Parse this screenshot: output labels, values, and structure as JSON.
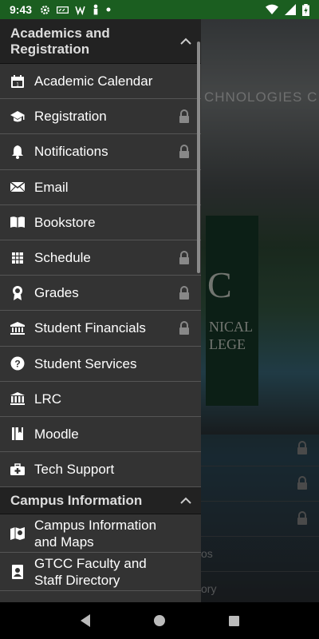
{
  "status_bar": {
    "time": "9:43",
    "left_icons": [
      "settings-icon",
      "quote-icon",
      "w-icon",
      "person-icon",
      "dot-icon"
    ],
    "right_icons": [
      "wifi-icon",
      "signal-icon",
      "battery-icon"
    ]
  },
  "background": {
    "banner_text": "CHNOLOGIES C",
    "sign_text": "C",
    "sign_sub_line1": "NICAL",
    "sign_sub_line2": "LEGE",
    "rows": [
      {
        "label": "",
        "locked": true
      },
      {
        "label": "",
        "locked": true
      },
      {
        "label": "",
        "locked": true
      },
      {
        "label": "os",
        "locked": false
      },
      {
        "label": "ory",
        "locked": false
      }
    ]
  },
  "drawer": {
    "sections": [
      {
        "title": "Academics and Registration",
        "expanded": true,
        "items": [
          {
            "label": "Academic Calendar",
            "icon": "calendar-icon",
            "locked": false
          },
          {
            "label": "Registration",
            "icon": "graduation-cap-icon",
            "locked": true
          },
          {
            "label": "Notifications",
            "icon": "bell-icon",
            "locked": true
          },
          {
            "label": "Email",
            "icon": "envelope-icon",
            "locked": false
          },
          {
            "label": "Bookstore",
            "icon": "book-icon",
            "locked": false
          },
          {
            "label": "Schedule",
            "icon": "grid-icon",
            "locked": true
          },
          {
            "label": "Grades",
            "icon": "award-icon",
            "locked": true
          },
          {
            "label": "Student Financials",
            "icon": "bank-icon",
            "locked": true
          },
          {
            "label": "Student Services",
            "icon": "question-icon",
            "locked": false
          },
          {
            "label": "LRC",
            "icon": "library-icon",
            "locked": false
          },
          {
            "label": "Moodle",
            "icon": "notebook-icon",
            "locked": false
          },
          {
            "label": "Tech Support",
            "icon": "first-aid-icon",
            "locked": false
          }
        ]
      },
      {
        "title": "Campus Information",
        "expanded": true,
        "items": [
          {
            "label": "Campus Information and Maps",
            "icon": "map-icon",
            "locked": false
          },
          {
            "label": "GTCC Faculty and Staff Directory",
            "icon": "contacts-icon",
            "locked": false
          }
        ]
      }
    ]
  },
  "nav_bar": {
    "buttons": [
      "back-icon",
      "home-icon",
      "recents-icon"
    ]
  },
  "colors": {
    "status_bar": "#1b5e20",
    "drawer_bg": "#333333",
    "section_header_bg": "#222222"
  }
}
